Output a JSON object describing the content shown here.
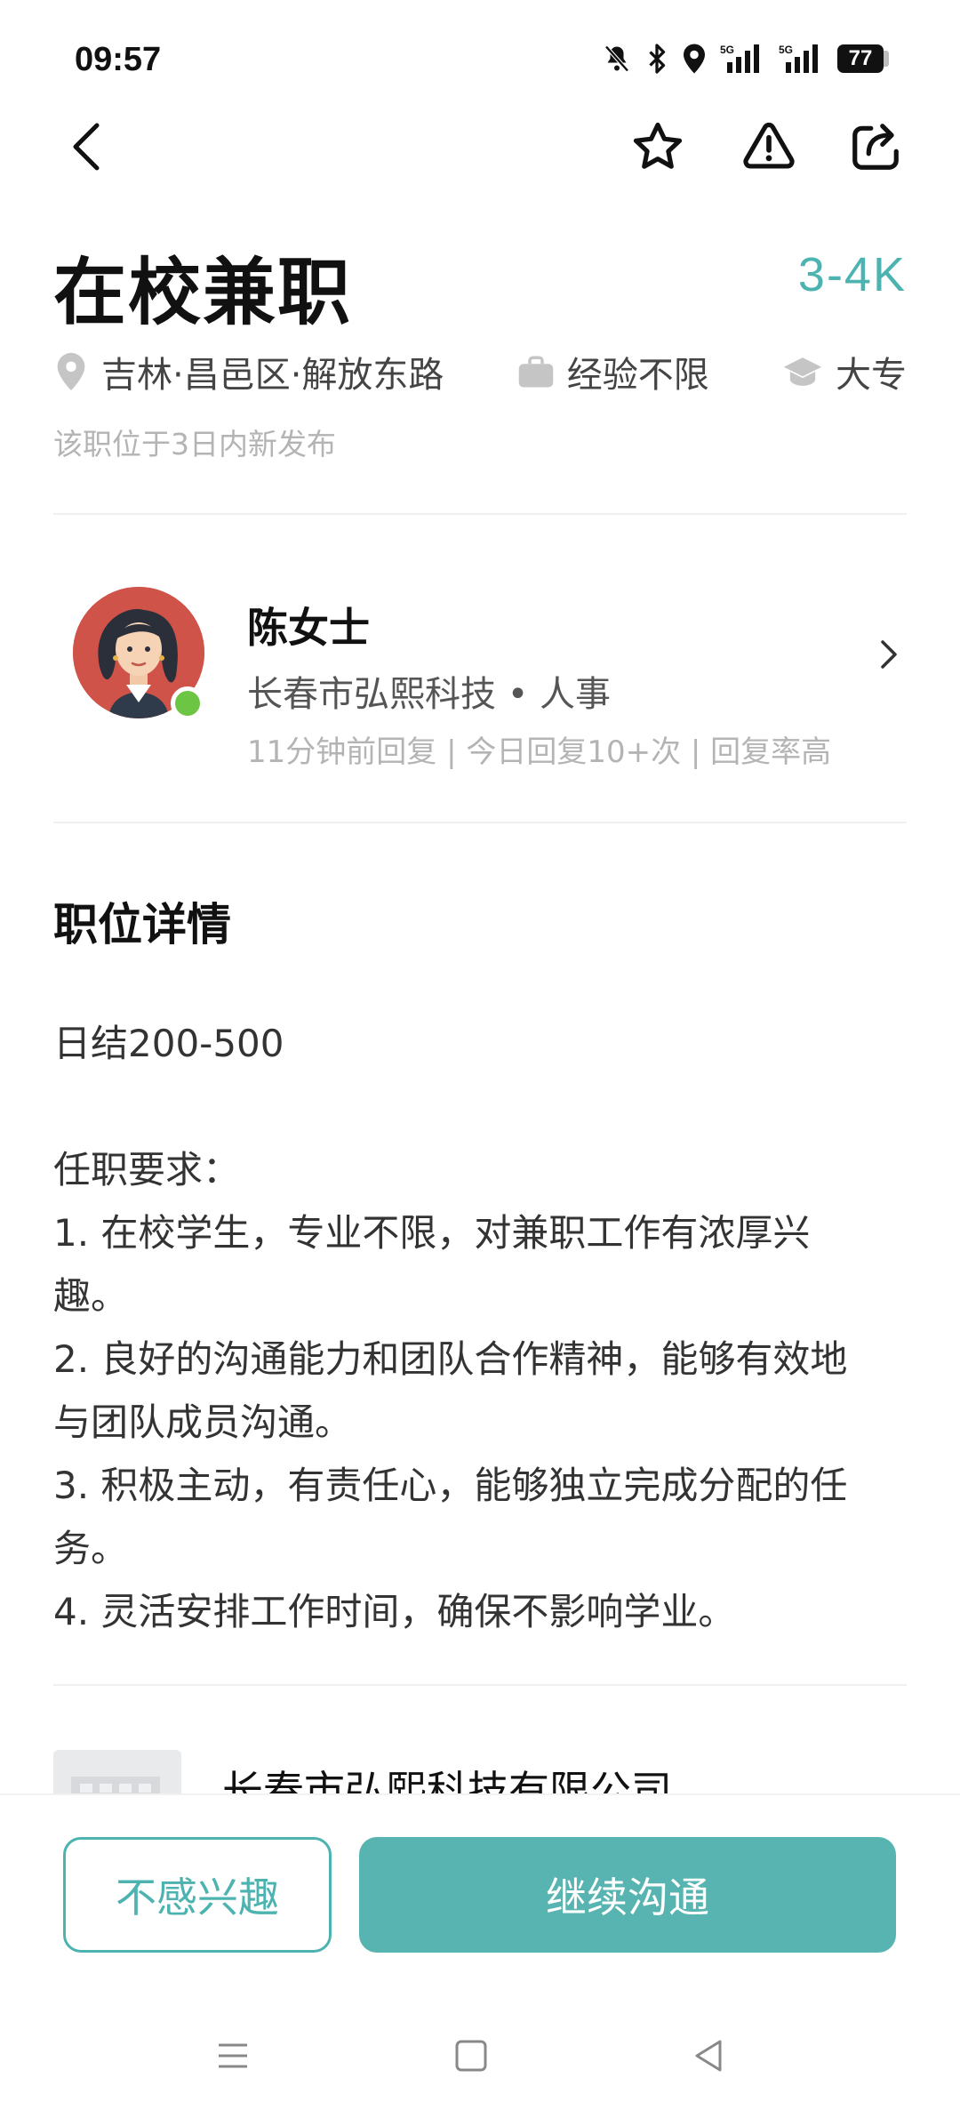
{
  "status_bar": {
    "time": "09:57",
    "battery": "77",
    "network_1": "5G",
    "network_2": "5G"
  },
  "toolbar": {
    "back_icon": "chevron-left-icon",
    "favorite_icon": "star-icon",
    "report_icon": "warning-icon",
    "share_icon": "share-icon"
  },
  "job": {
    "title": "在校兼职",
    "salary": "3-4K",
    "location": "吉林·昌邑区·解放东路",
    "experience": "经验不限",
    "education": "大专",
    "posted_note": "该职位于3日内新发布"
  },
  "recruiter": {
    "name": "陈女士",
    "company_role": "长春市弘熙科技 • 人事",
    "stats": "11分钟前回复 | 今日回复10+次 | 回复率高"
  },
  "details": {
    "title": "职位详情",
    "lines": [
      "日结200-500",
      "",
      "任职要求：",
      "1. 在校学生，专业不限，对兼职工作有浓厚兴",
      "趣。",
      "2. 良好的沟通能力和团队合作精神，能够有效地",
      "与团队成员沟通。",
      "3. 积极主动，有责任心，能够独立完成分配的任",
      "务。",
      "4. 灵活安排工作时间，确保不影响学业。"
    ]
  },
  "company": {
    "name": "长春市弘熙科技有限公司"
  },
  "actions": {
    "not_interested": "不感兴趣",
    "continue_chat": "继续沟通"
  },
  "colors": {
    "accent": "#4db3b0",
    "primary_button": "#58b4b0",
    "online": "#6cc644"
  }
}
